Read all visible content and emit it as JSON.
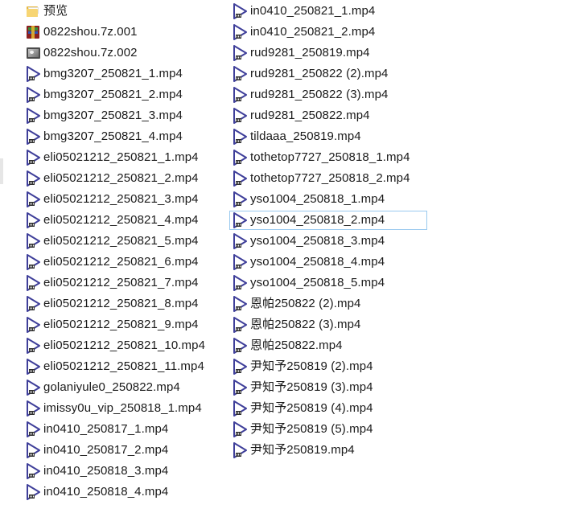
{
  "column1": [
    {
      "name": "预览",
      "icon": "folder-icon"
    },
    {
      "name": "0822shou.7z.001",
      "icon": "archive-icon"
    },
    {
      "name": "0822shou.7z.002",
      "icon": "image-icon"
    },
    {
      "name": "bmg3207_250821_1.mp4",
      "icon": "video-file-icon"
    },
    {
      "name": "bmg3207_250821_2.mp4",
      "icon": "video-file-icon"
    },
    {
      "name": "bmg3207_250821_3.mp4",
      "icon": "video-file-icon"
    },
    {
      "name": "bmg3207_250821_4.mp4",
      "icon": "video-file-icon"
    },
    {
      "name": "eli05021212_250821_1.mp4",
      "icon": "video-file-icon"
    },
    {
      "name": "eli05021212_250821_2.mp4",
      "icon": "video-file-icon"
    },
    {
      "name": "eli05021212_250821_3.mp4",
      "icon": "video-file-icon"
    },
    {
      "name": "eli05021212_250821_4.mp4",
      "icon": "video-file-icon"
    },
    {
      "name": "eli05021212_250821_5.mp4",
      "icon": "video-file-icon"
    },
    {
      "name": "eli05021212_250821_6.mp4",
      "icon": "video-file-icon"
    },
    {
      "name": "eli05021212_250821_7.mp4",
      "icon": "video-file-icon"
    },
    {
      "name": "eli05021212_250821_8.mp4",
      "icon": "video-file-icon"
    },
    {
      "name": "eli05021212_250821_9.mp4",
      "icon": "video-file-icon"
    },
    {
      "name": "eli05021212_250821_10.mp4",
      "icon": "video-file-icon"
    },
    {
      "name": "eli05021212_250821_11.mp4",
      "icon": "video-file-icon"
    },
    {
      "name": "golaniyule0_250822.mp4",
      "icon": "video-file-icon"
    },
    {
      "name": "imissy0u_vip_250818_1.mp4",
      "icon": "video-file-icon"
    },
    {
      "name": "in0410_250817_1.mp4",
      "icon": "video-file-icon"
    },
    {
      "name": "in0410_250817_2.mp4",
      "icon": "video-file-icon"
    },
    {
      "name": "in0410_250818_3.mp4",
      "icon": "video-file-icon"
    },
    {
      "name": "in0410_250818_4.mp4",
      "icon": "video-file-icon"
    }
  ],
  "column2": [
    {
      "name": "in0410_250821_1.mp4",
      "icon": "video-file-icon"
    },
    {
      "name": "in0410_250821_2.mp4",
      "icon": "video-file-icon"
    },
    {
      "name": "rud9281_250819.mp4",
      "icon": "video-file-icon"
    },
    {
      "name": "rud9281_250822 (2).mp4",
      "icon": "video-file-icon"
    },
    {
      "name": "rud9281_250822 (3).mp4",
      "icon": "video-file-icon"
    },
    {
      "name": "rud9281_250822.mp4",
      "icon": "video-file-icon"
    },
    {
      "name": "tildaaa_250819.mp4",
      "icon": "video-file-icon"
    },
    {
      "name": "tothetop7727_250818_1.mp4",
      "icon": "video-file-icon"
    },
    {
      "name": "tothetop7727_250818_2.mp4",
      "icon": "video-file-icon"
    },
    {
      "name": "yso1004_250818_1.mp4",
      "icon": "video-file-icon"
    },
    {
      "name": "yso1004_250818_2.mp4",
      "icon": "video-file-icon",
      "hovered": true
    },
    {
      "name": "yso1004_250818_3.mp4",
      "icon": "video-file-icon"
    },
    {
      "name": "yso1004_250818_4.mp4",
      "icon": "video-file-icon"
    },
    {
      "name": "yso1004_250818_5.mp4",
      "icon": "video-file-icon"
    },
    {
      "name": "恩帕250822 (2).mp4",
      "icon": "video-file-icon"
    },
    {
      "name": "恩帕250822 (3).mp4",
      "icon": "video-file-icon"
    },
    {
      "name": "恩帕250822.mp4",
      "icon": "video-file-icon"
    },
    {
      "name": "尹知予250819 (2).mp4",
      "icon": "video-file-icon"
    },
    {
      "name": "尹知予250819 (3).mp4",
      "icon": "video-file-icon"
    },
    {
      "name": "尹知予250819 (4).mp4",
      "icon": "video-file-icon"
    },
    {
      "name": "尹知予250819 (5).mp4",
      "icon": "video-file-icon"
    },
    {
      "name": "尹知予250819.mp4",
      "icon": "video-file-icon"
    }
  ],
  "colors": {
    "video_icon": "#3f3f9a",
    "hover_border": "#99c9ef",
    "text": "#1a1a1a"
  }
}
